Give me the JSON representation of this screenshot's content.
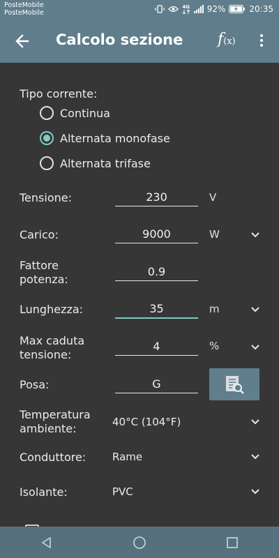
{
  "status_bar": {
    "carrier_line1": "PosteMobile",
    "carrier_line2": "PosteMobile",
    "network": "4G",
    "battery": "92%",
    "time": "20:35"
  },
  "app_bar": {
    "title": "Calcolo sezione",
    "fx_label": "f",
    "fx_sub": "(x)"
  },
  "form": {
    "current_type_label": "Tipo corrente:",
    "current_options": [
      {
        "label": "Continua",
        "checked": false
      },
      {
        "label": "Alternata monofase",
        "checked": true
      },
      {
        "label": "Alternata trifase",
        "checked": false
      }
    ],
    "voltage": {
      "label": "Tensione:",
      "value": "230",
      "unit": "V"
    },
    "load": {
      "label": "Carico:",
      "value": "9000",
      "unit": "W"
    },
    "power_factor": {
      "label_line1": "Fattore",
      "label_line2": "potenza:",
      "value": "0.9"
    },
    "length": {
      "label": "Lunghezza:",
      "value": "35",
      "unit": "m"
    },
    "max_drop": {
      "label_line1": "Max caduta",
      "label_line2": "tensione:",
      "value": "4",
      "unit": "%"
    },
    "laying": {
      "label": "Posa:",
      "value": "G"
    },
    "temperature": {
      "label_line1": "Temperatura",
      "label_line2": "ambiente:",
      "value": "40°C (104°F)"
    },
    "conductor": {
      "label": "Conduttore:",
      "value": "Rame"
    },
    "insulation": {
      "label": "Isolante:",
      "value": "PVC"
    }
  },
  "colors": {
    "accent": "#80cbc4",
    "toolbar": "#5f7d8b",
    "background": "#363636"
  }
}
